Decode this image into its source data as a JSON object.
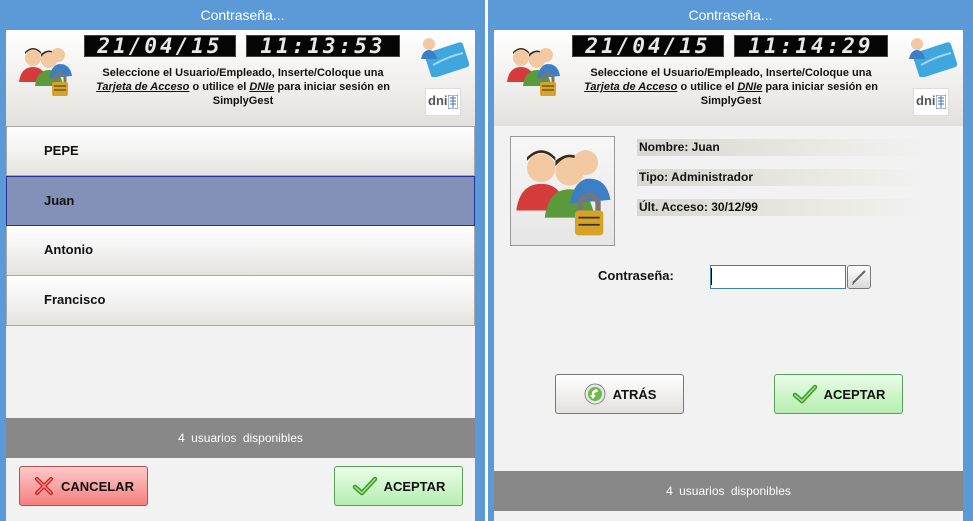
{
  "left": {
    "title": "Contraseña...",
    "clock": {
      "date": "21/04/15",
      "time": "11:13:53"
    },
    "instructions": {
      "line1": "Seleccione el Usuario/Empleado, Inserte/Coloque una",
      "card_link": "Tarjeta de Acceso",
      "mid": " o utilice el ",
      "dni_link": "DNIe",
      "tail": " para iniciar sesión en",
      "line3": "SimplyGest"
    },
    "dni_logo": "dni",
    "users": [
      "PEPE",
      "Juan",
      "Antonio",
      "Francisco"
    ],
    "selected_user": "Juan",
    "status": "4 usuarios disponibles",
    "cancel_label": "CANCELAR",
    "accept_label": "ACEPTAR"
  },
  "right": {
    "title": "Contraseña...",
    "clock": {
      "date": "21/04/15",
      "time": "11:14:29"
    },
    "instructions": {
      "line1": "Seleccione el Usuario/Empleado, Inserte/Coloque una",
      "card_link": "Tarjeta de Acceso",
      "mid": " o utilice el ",
      "dni_link": "DNIe",
      "tail": " para iniciar sesión en",
      "line3": "SimplyGest"
    },
    "dni_logo": "dni",
    "info": {
      "name": "Nombre: Juan",
      "type": "Tipo: Administrador",
      "last_access": "Últ. Acceso: 30/12/99"
    },
    "password_label": "Contraseña:",
    "password_value": "",
    "back_label": "ATRÁS",
    "accept_label": "ACEPTAR",
    "status": "4 usuarios disponibles"
  },
  "colors": {
    "titlebar": "#5b9ad6",
    "selected_row": "#8391b8",
    "status_bar": "#888888",
    "cancel": "#f57f7f",
    "accept": "#b6eeb0"
  },
  "icons": [
    "users-lock-icon",
    "access-card-icon",
    "dnie-logo",
    "close-x-icon",
    "checkmark-icon",
    "back-arrow-icon",
    "keyboard-pen-icon"
  ]
}
